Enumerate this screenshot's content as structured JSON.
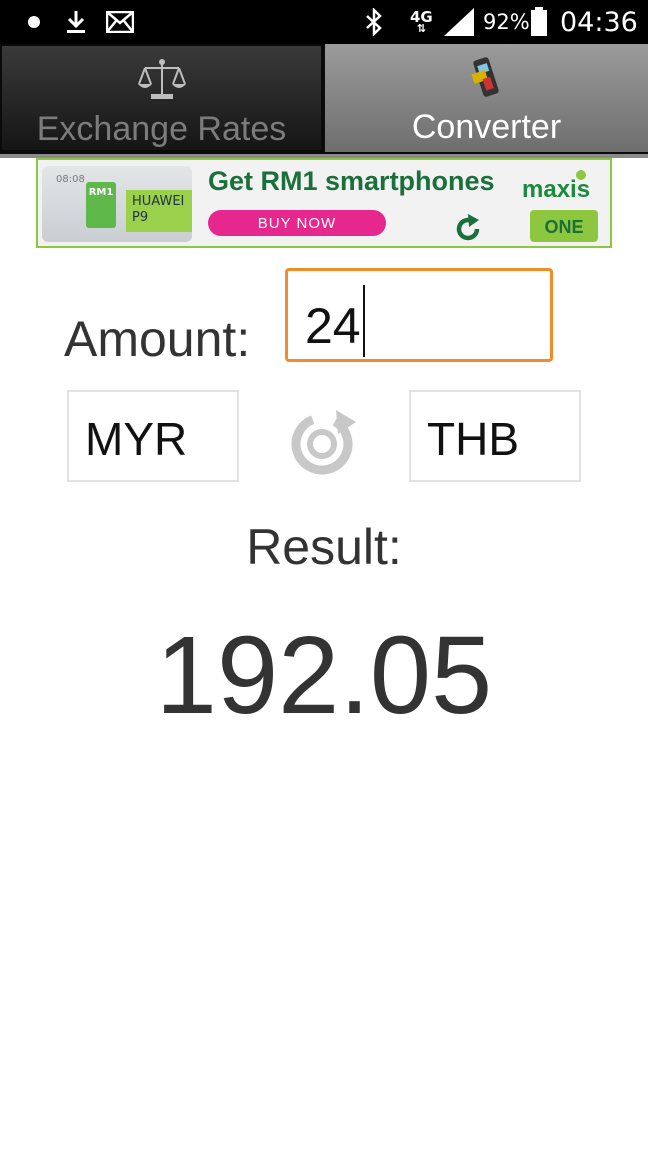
{
  "status_bar": {
    "network": "4G",
    "battery": "92%",
    "time": "04:36"
  },
  "tabs": [
    {
      "label": "Exchange Rates",
      "icon": "scale-icon",
      "active": false
    },
    {
      "label": "Converter",
      "icon": "card-terminal-icon",
      "active": true
    }
  ],
  "ad": {
    "phone_time": "08:08",
    "rm1": "RM1",
    "model": "HUAWEI P9",
    "headline": "Get RM1 smartphones",
    "cta": "BUY NOW",
    "brand": "maxis",
    "logo_text": "ONE",
    "accent": "#8dc63f",
    "cta_color": "#e6278e"
  },
  "converter": {
    "amount_label": "Amount:",
    "amount_value": "24",
    "from_currency": "MYR",
    "to_currency": "THB",
    "result_label": "Result:",
    "result_value": "192.05",
    "input_border_color": "#f28c28"
  }
}
